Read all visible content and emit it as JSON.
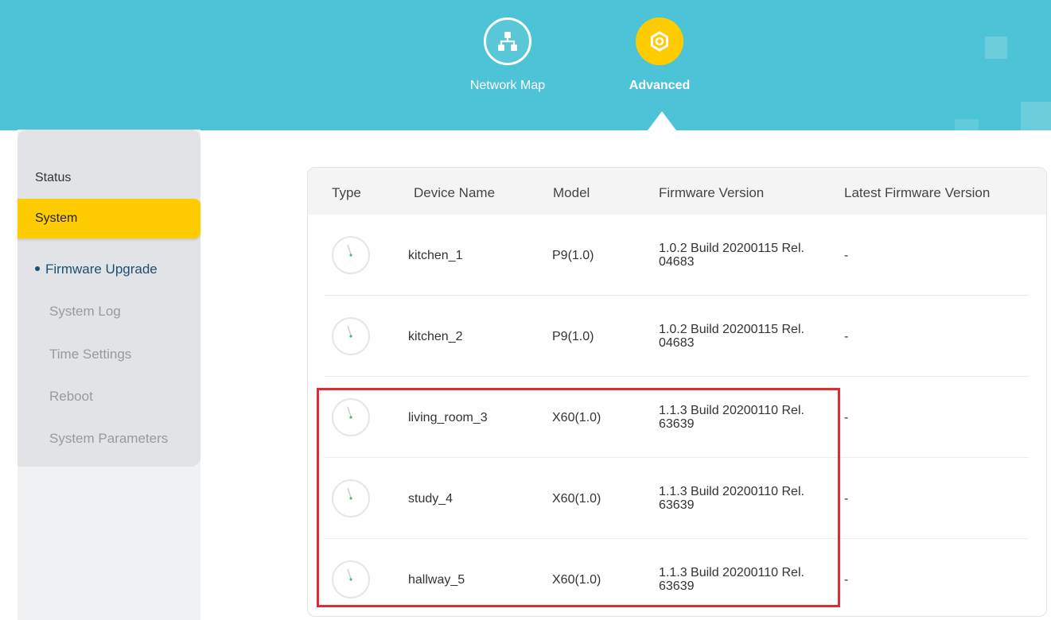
{
  "nav": {
    "items": [
      {
        "label": "Network Map",
        "icon": "network-map-icon",
        "active": false
      },
      {
        "label": "Advanced",
        "icon": "advanced-gear-icon",
        "active": true
      }
    ]
  },
  "sidebar": {
    "status_label": "Status",
    "system_label": "System",
    "subitems": [
      {
        "label": "Firmware Upgrade",
        "active": true
      },
      {
        "label": "System Log",
        "active": false
      },
      {
        "label": "Time Settings",
        "active": false
      },
      {
        "label": "Reboot",
        "active": false
      },
      {
        "label": "System Parameters",
        "active": false
      }
    ]
  },
  "table": {
    "headers": {
      "type": "Type",
      "device_name": "Device Name",
      "model": "Model",
      "firmware_version": "Firmware Version",
      "latest_firmware_version": "Latest Firmware Version"
    },
    "rows": [
      {
        "icon": "device-icon",
        "name": "kitchen_1",
        "model": "P9(1.0)",
        "firmware": "1.0.2 Build 20200115 Rel. 04683",
        "latest": "-"
      },
      {
        "icon": "device-icon",
        "name": "kitchen_2",
        "model": "P9(1.0)",
        "firmware": "1.0.2 Build 20200115 Rel. 04683",
        "latest": "-"
      },
      {
        "icon": "device-icon",
        "name": "living_room_3",
        "model": "X60(1.0)",
        "firmware": "1.1.3 Build 20200110 Rel. 63639",
        "latest": "-"
      },
      {
        "icon": "device-icon",
        "name": "study_4",
        "model": "X60(1.0)",
        "firmware": "1.1.3 Build 20200110 Rel. 63639",
        "latest": "-"
      },
      {
        "icon": "device-icon",
        "name": "hallway_5",
        "model": "X60(1.0)",
        "firmware": "1.1.3 Build 20200110 Rel. 63639",
        "latest": "-"
      }
    ]
  },
  "colors": {
    "header_bg": "#4cc3d6",
    "accent_yellow": "#ffcc00",
    "highlight_red": "#e02a34",
    "active_text": "#1e4f6e"
  }
}
